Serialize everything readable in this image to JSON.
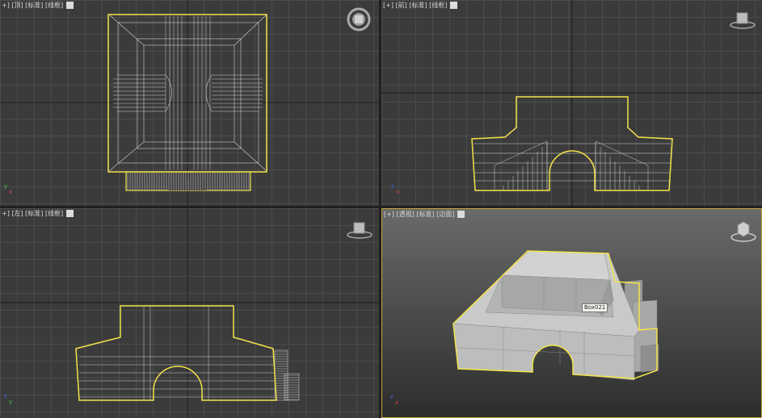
{
  "viewports": {
    "top": {
      "bracket_plus": "+]",
      "view": "[顶]",
      "shading": "[标准]",
      "mode": "[线框]"
    },
    "front": {
      "bracket_plus": "[+]",
      "view": "[前]",
      "shading": "[标准]",
      "mode": "[线框]"
    },
    "left": {
      "bracket_plus": "+]",
      "view": "[左]",
      "shading": "[标准]",
      "mode": "[线框]"
    },
    "persp": {
      "bracket_plus": "[+]",
      "view": "[透视]",
      "shading": "[标准]",
      "mode": "[边面]"
    }
  },
  "object_tooltip": "Box021",
  "axis": {
    "y": "y",
    "x": "x",
    "z": "z"
  },
  "colors": {
    "selection": "#f2e34b",
    "wire": "#d2d2d2",
    "axis_x": "#e04040",
    "axis_y": "#40c040",
    "axis_z": "#4060e0",
    "active_border": "#c8a040"
  },
  "icons": [
    "viewcube-icon",
    "steering-wheel-icon"
  ]
}
